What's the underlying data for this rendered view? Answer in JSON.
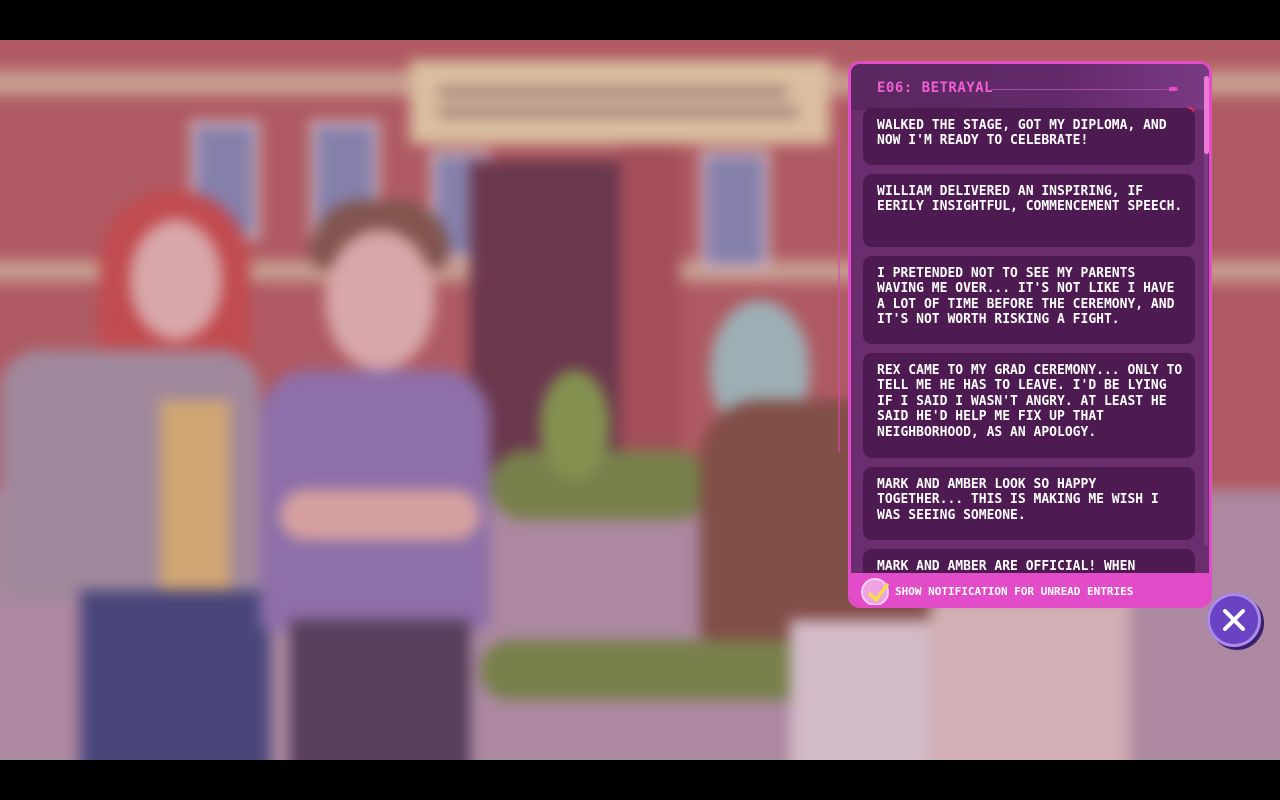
{
  "journal": {
    "title": "E06: BETRAYAL",
    "entries": [
      {
        "text": "WALKED THE STAGE, GOT MY DIPLOMA, AND NOW I'M READY TO CELEBRATE!"
      },
      {
        "text": "WILLIAM DELIVERED AN INSPIRING, IF EERILY INSIGHTFUL, COMMENCEMENT SPEECH."
      },
      {
        "text": "I PRETENDED NOT TO SEE MY PARENTS WAVING ME OVER... IT'S NOT LIKE I HAVE A LOT OF TIME BEFORE THE CEREMONY, AND IT'S NOT WORTH RISKING A FIGHT."
      },
      {
        "text": "REX CAME TO MY GRAD CEREMONY... ONLY TO TELL ME HE HAS TO LEAVE. I'D BE LYING IF I SAID I WASN'T ANGRY. AT LEAST HE SAID HE'D HELP ME FIX UP THAT NEIGHBORHOOD, AS AN APOLOGY."
      },
      {
        "text": "MARK AND AMBER LOOK SO HAPPY TOGETHER... THIS IS MAKING ME WISH I WAS SEEING SOMEONE."
      },
      {
        "text": "MARK AND AMBER ARE OFFICIAL! WHEN"
      }
    ],
    "footer": {
      "checkbox_checked": true,
      "label": "Show notification for unread entries"
    }
  },
  "colors": {
    "panel_border": "#e24cc8",
    "panel_bg": "#6a2d6e",
    "entry_bg": "#4e1a52",
    "title": "#f05fd0",
    "close_button": "#6a43c4"
  },
  "icons": {
    "checkbox": "checkmark-icon",
    "close": "close-icon"
  }
}
